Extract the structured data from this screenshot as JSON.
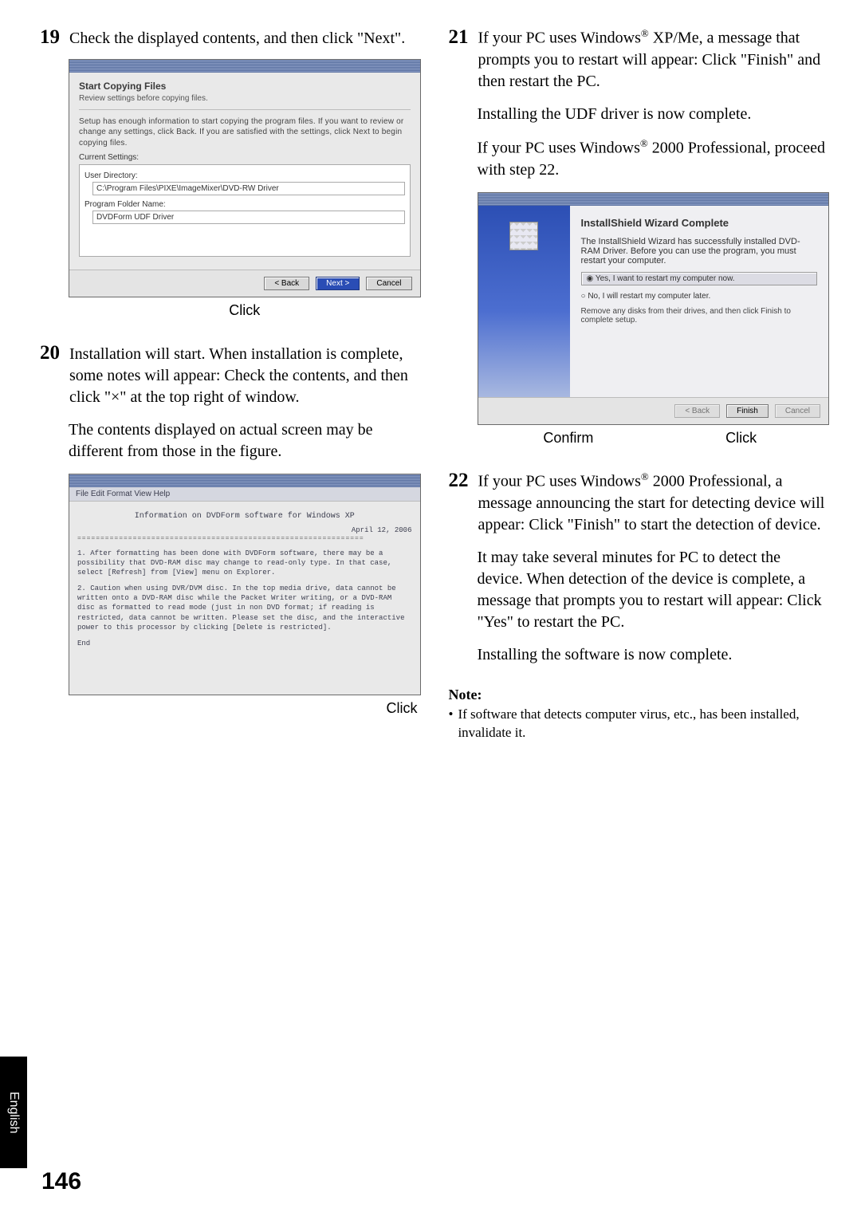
{
  "language_tab": "English",
  "page_number": "146",
  "left": {
    "step19": {
      "num": "19",
      "text": "Check the displayed contents, and then click \"Next\".",
      "dlg": {
        "title": "Start Copying Files",
        "subtitle": "Review settings before copying files.",
        "body": "Setup has enough information to start copying the program files. If you want to review or change any settings, click Back. If you are satisfied with the settings, click Next to begin copying files.",
        "cur_set_label": "Current Settings:",
        "user_dir_label": "User Directory:",
        "user_dir_value": "C:\\Program Files\\PIXE\\ImageMixer\\DVD-RW Driver",
        "prog_folder_label": "Program Folder Name:",
        "prog_folder_value": "DVDForm UDF Driver",
        "btn_back": "< Back",
        "btn_next": "Next >",
        "btn_cancel": "Cancel"
      },
      "click_label": "Click"
    },
    "step20": {
      "num": "20",
      "text_a": "Installation will start. When installation is complete, some notes will appear: Check the contents, and then click \"×\" at the top right of window.",
      "text_b": "The contents displayed on actual screen may be different from those in the figure.",
      "readme": {
        "menu": "File  Edit  Format  View  Help",
        "title": "Information on DVDForm software for Windows XP",
        "date": "April 12, 2006",
        "line1": "1. After formatting has been done with DVDForm software, there may be a possibility that DVD-RAM disc may change to read-only type. In that case, select [Refresh] from [View] menu on Explorer.",
        "line2": "2. Caution when using DVR/DVM disc. In the top media drive, data cannot be written onto a DVD-RAM disc while the Packet Writer writing, or a DVD-RAM disc as formatted to read mode (just in non DVD format; if reading is restricted, data cannot be written. Please set the disc, and the interactive power to this processor by clicking [Delete is restricted].",
        "end": "End"
      },
      "click_label": "Click"
    }
  },
  "right": {
    "step21": {
      "num": "21",
      "text_a_pre": "If your PC uses Windows",
      "text_a_post": " XP/Me, a message that prompts you to restart will appear: Click \"Finish\" and then restart the PC.",
      "para_b": "Installing the UDF driver is now complete.",
      "para_c_pre": "If your PC uses Windows",
      "para_c_post": " 2000 Professional, proceed with step 22.",
      "wiz": {
        "title": "InstallShield Wizard Complete",
        "body": "The InstallShield Wizard has successfully installed DVD-RAM Driver. Before you can use the program, you must restart your computer.",
        "option_box": "Yes, I want to restart my computer now.",
        "option_no": "No, I will restart my computer later.",
        "small": "Remove any disks from their drives, and then click Finish to complete setup.",
        "btn_back": "< Back",
        "btn_finish": "Finish",
        "btn_cancel": "Cancel"
      },
      "confirm_label": "Confirm",
      "click_label": "Click"
    },
    "step22": {
      "num": "22",
      "text_a_pre": "If your PC uses Windows",
      "text_a_post": " 2000 Professional, a message announcing the start for detecting device will appear: Click \"Finish\" to start the detection of device.",
      "para_b": "It may take several minutes for PC to detect the device. When detection of the device is complete, a message that prompts you to restart will appear: Click \"Yes\" to restart the PC.",
      "para_c": "Installing the software is now complete."
    },
    "note": {
      "head": "Note:",
      "bullet": "•",
      "body": "If software that detects computer virus, etc., has been installed, invalidate it."
    }
  },
  "registered": "®"
}
